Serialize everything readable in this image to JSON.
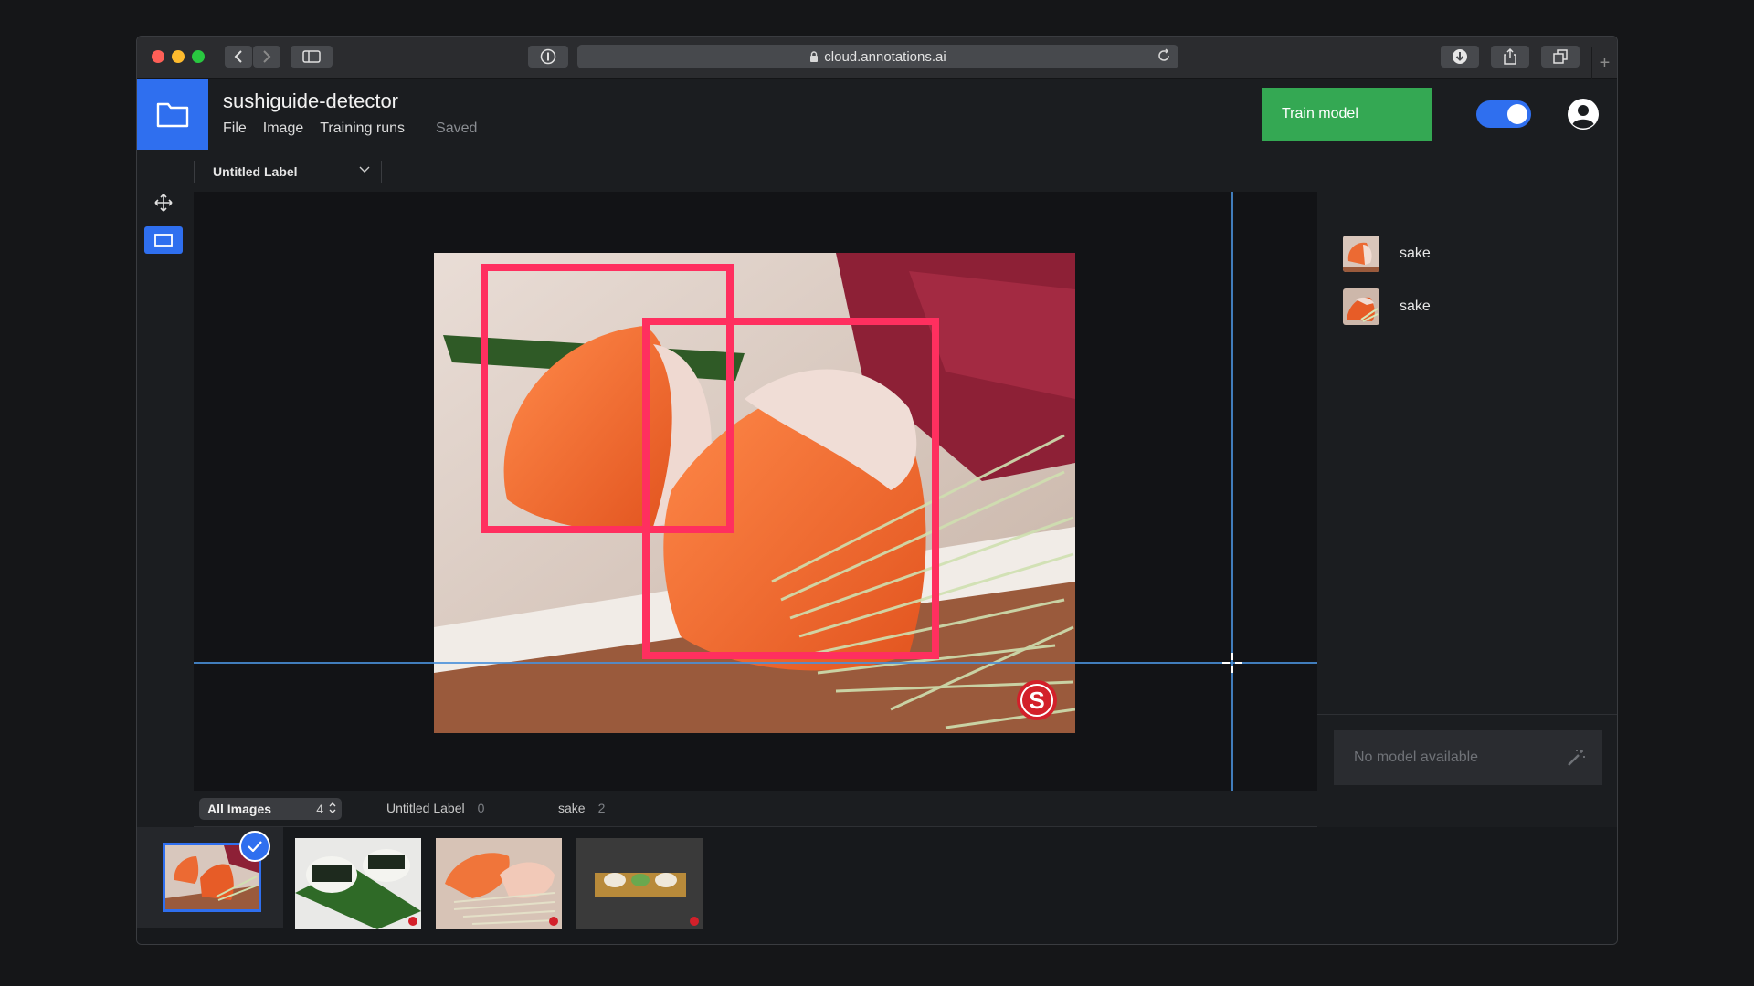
{
  "browser": {
    "url": "cloud.annotations.ai"
  },
  "header": {
    "project_title": "sushiguide-detector",
    "menu": [
      "File",
      "Image",
      "Training runs"
    ],
    "status": "Saved",
    "train_button": "Train model",
    "toggle_on": true
  },
  "labelbar": {
    "selected_label": "Untitled Label"
  },
  "annotations": [
    {
      "label": "sake"
    },
    {
      "label": "sake"
    }
  ],
  "model_panel": {
    "placeholder": "No model available"
  },
  "filterbar": {
    "filter": "All Images",
    "filter_count": "4",
    "tags": [
      {
        "name": "Untitled Label",
        "count": "0"
      },
      {
        "name": "sake",
        "count": "2"
      }
    ]
  },
  "thumbnails": {
    "count": 4,
    "selected_index": 0
  },
  "colors": {
    "accent": "#2f6fef",
    "train": "#34a853",
    "bbox": "#ff2f5f",
    "guide": "#4a90d9"
  }
}
